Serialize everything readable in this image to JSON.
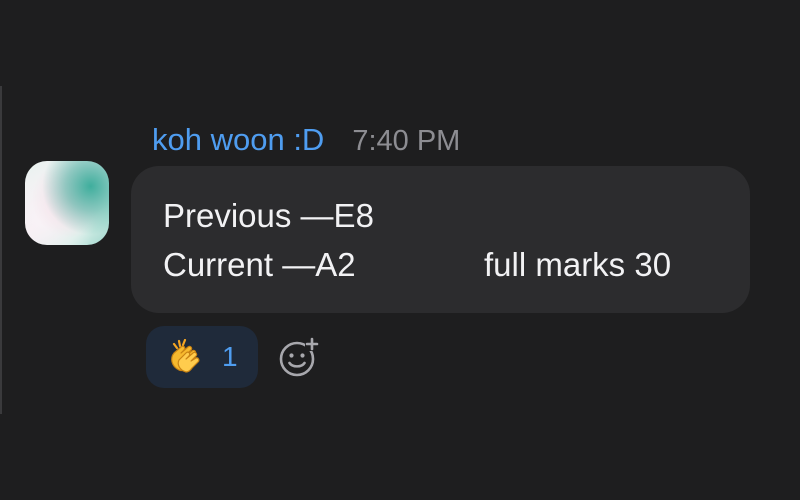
{
  "message": {
    "sender": "koh woon :D",
    "time": "7:40 PM",
    "line1": "Previous —E8",
    "line2_left": "Current —A2",
    "line2_right": "full marks 30"
  },
  "reaction": {
    "emoji_icon": "clapping-hands-icon",
    "count": "1"
  },
  "add_reaction": {
    "icon": "add-emoji-icon"
  },
  "colors": {
    "background": "#1e1e1f",
    "bubble": "#2c2c2e",
    "accent": "#4f9df0",
    "timestamp": "#8d8d92",
    "text": "#f2f2f4"
  }
}
